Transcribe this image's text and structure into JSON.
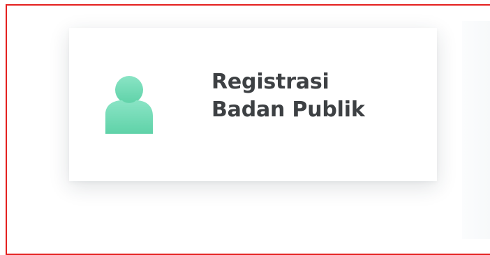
{
  "card": {
    "title_line1": "Registrasi",
    "title_line2": "Badan Publik",
    "icon": "user-icon",
    "icon_color_top": "#86e2c2",
    "icon_color_bottom": "#5fd2a8",
    "border_color": "#e4201f"
  }
}
